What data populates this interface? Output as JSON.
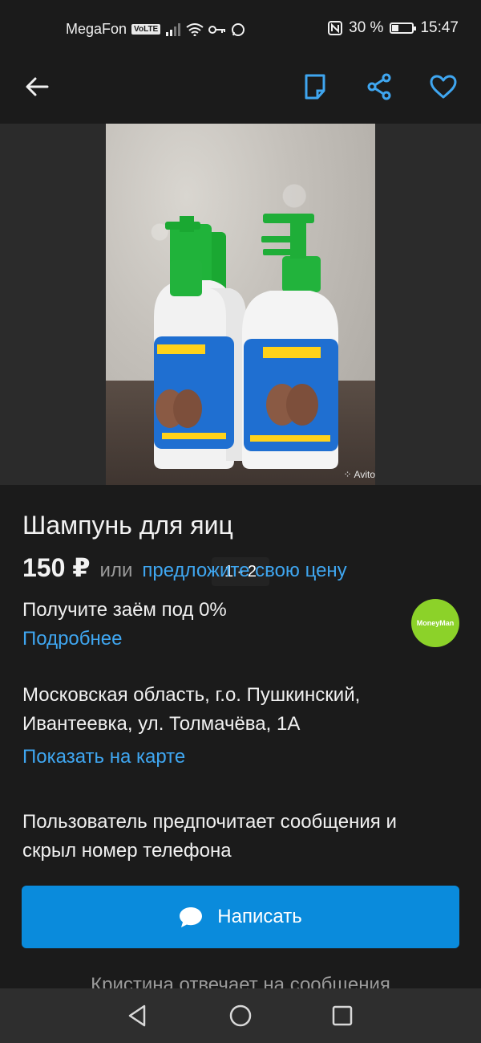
{
  "status_bar": {
    "carrier": "MegaFon",
    "volte": "VoLTE",
    "battery_percent": "30 %",
    "battery_level": 0.3,
    "time": "15:47"
  },
  "toolbar": {
    "icons": [
      "back-arrow-icon",
      "note-icon",
      "share-icon",
      "heart-icon"
    ],
    "accent_color": "#3fa6f0"
  },
  "gallery": {
    "counter": "1 - 2",
    "watermark": "Avito"
  },
  "listing": {
    "title": "Шампунь для яиц",
    "price": "150 ₽",
    "or_text": "или",
    "offer_link": "предложите свою цену"
  },
  "loan": {
    "text": "Получите заём под 0%",
    "more_link": "Подробнее",
    "partner_logo": "MoneyMan",
    "partner_color": "#8cd229"
  },
  "location": {
    "line1": "Московская область, г.о. Пушкинский,",
    "line2": "Ивантеевка, ул. Толмачёва, 1А",
    "map_link": "Показать на карте"
  },
  "contact": {
    "preference_line1": "Пользователь предпочитает сообщения и",
    "preference_line2": "скрыл номер телефона",
    "write_button": "Написать",
    "button_color": "#0a8bdc",
    "replies_text": "Кристина отвечает на сообщения"
  }
}
